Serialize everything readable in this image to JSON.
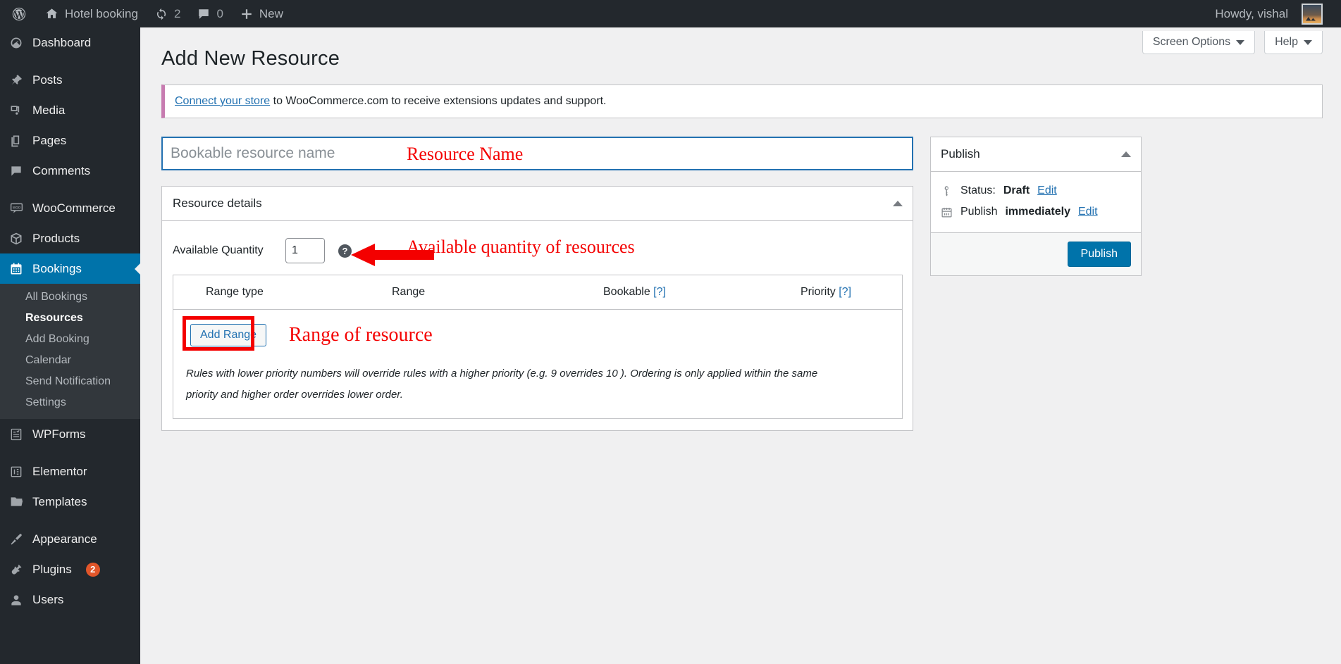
{
  "adminbar": {
    "wp_logo": "wordpress-logo-icon",
    "site_name": "Hotel booking",
    "updates_count": "2",
    "comments_count": "0",
    "new_label": "New",
    "howdy": "Howdy, vishal"
  },
  "sidebar": {
    "items": [
      {
        "label": "Dashboard",
        "icon": "dashboard-icon",
        "active": false
      },
      {
        "label": "Posts",
        "icon": "pin-icon",
        "active": false
      },
      {
        "label": "Media",
        "icon": "media-icon",
        "active": false
      },
      {
        "label": "Pages",
        "icon": "pages-icon",
        "active": false
      },
      {
        "label": "Comments",
        "icon": "comment-icon",
        "active": false
      },
      {
        "label": "WooCommerce",
        "icon": "woocommerce-icon",
        "active": false
      },
      {
        "label": "Products",
        "icon": "products-box-icon",
        "active": false
      },
      {
        "label": "Bookings",
        "icon": "calendar-icon",
        "active": true
      },
      {
        "label": "WPForms",
        "icon": "wpforms-icon",
        "active": false
      },
      {
        "label": "Elementor",
        "icon": "elementor-icon",
        "active": false
      },
      {
        "label": "Templates",
        "icon": "folder-icon",
        "active": false
      },
      {
        "label": "Appearance",
        "icon": "paintbrush-icon",
        "active": false
      },
      {
        "label": "Plugins",
        "icon": "plug-icon",
        "active": false,
        "badge": "2"
      },
      {
        "label": "Users",
        "icon": "user-icon",
        "active": false
      }
    ],
    "submenu": [
      {
        "label": "All Bookings",
        "current": false
      },
      {
        "label": "Resources",
        "current": true
      },
      {
        "label": "Add Booking",
        "current": false
      },
      {
        "label": "Calendar",
        "current": false
      },
      {
        "label": "Send Notification",
        "current": false
      },
      {
        "label": "Settings",
        "current": false
      }
    ]
  },
  "screen_meta": {
    "screen_options": "Screen Options",
    "help": "Help"
  },
  "page": {
    "title": "Add New Resource",
    "notice_link": "Connect your store",
    "notice_text": " to WooCommerce.com to receive extensions updates and support."
  },
  "title_field": {
    "placeholder": "Bookable resource name",
    "value": ""
  },
  "annotations": {
    "resource_name": "Resource Name",
    "available_quantity": "Available quantity of resources",
    "range_of_resource": "Range of resource",
    "color": "#f40000"
  },
  "resource_details": {
    "panel_title": "Resource details",
    "quantity_label": "Available Quantity",
    "quantity_value": "1",
    "help_tip": "?",
    "table_headers": {
      "range_type": "Range type",
      "range": "Range",
      "bookable": "Bookable",
      "bookable_help": "[?]",
      "priority": "Priority",
      "priority_help": "[?]"
    },
    "add_range_label": "Add Range",
    "rules_text": "Rules with lower priority numbers will override rules with a higher priority (e.g. 9 overrides 10 ). Ordering is only applied within the same priority and higher order overrides lower order."
  },
  "publish_box": {
    "title": "Publish",
    "status_label": "Status:",
    "status_value": "Draft",
    "status_edit": "Edit",
    "schedule_label": "Publish",
    "schedule_value": "immediately",
    "schedule_edit": "Edit",
    "publish_button": "Publish"
  }
}
